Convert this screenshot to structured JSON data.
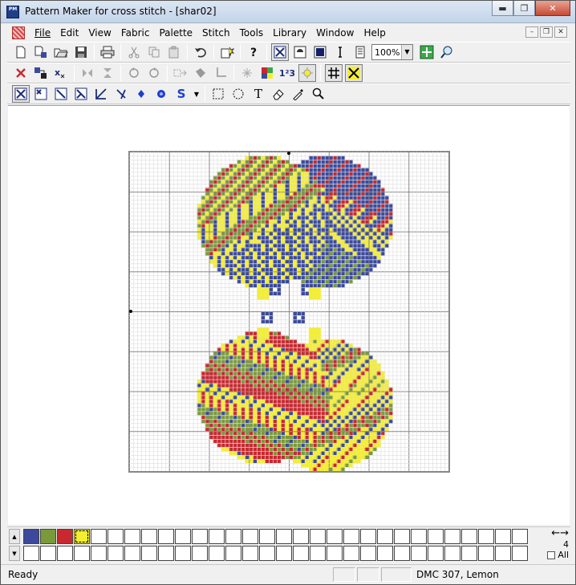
{
  "window": {
    "title": "Pattern Maker for cross stitch - [shar02]",
    "app_icon_text": "PM"
  },
  "menubar": {
    "items": [
      "File",
      "Edit",
      "View",
      "Fabric",
      "Palette",
      "Stitch",
      "Tools",
      "Library",
      "Window",
      "Help"
    ]
  },
  "toolbar1": {
    "zoom_value": "100%",
    "icons": [
      "new-icon",
      "copy-new-icon",
      "open-icon",
      "save-icon",
      "print-icon",
      "cut-icon",
      "copy-icon",
      "paste-icon",
      "undo-icon",
      "paste-special-icon",
      "help-icon",
      "full-stitch-view-icon",
      "symbol-view-icon",
      "block-view-icon",
      "text-icon",
      "pattern-info-icon",
      "zoom-fit-icon",
      "zoom-tool-icon"
    ]
  },
  "toolbar2": {
    "icons": [
      "delete-icon",
      "move-icon",
      "swap-color-icon",
      "flip-horizontal-icon",
      "flip-vertical-icon",
      "rotate-left-icon",
      "rotate-right-icon",
      "shift-icon",
      "fill-icon",
      "crop-icon",
      "select-icon",
      "palette-icon",
      "numbers-icon",
      "sparkle-icon",
      "grid-icon",
      "show-stitches-icon"
    ],
    "numbers_label": "1²3"
  },
  "toolbar3": {
    "icons": [
      "full-stitch-icon",
      "quarter-stitch-icon",
      "half-stitch-icon",
      "three-quarter-stitch-icon",
      "backstitch-icon",
      "straight-stitch-icon",
      "french-knot-icon",
      "bead-icon",
      "specialty-stitch-icon",
      "rectangle-select-icon",
      "lasso-select-icon",
      "text-tool-icon",
      "eraser-icon",
      "color-picker-icon",
      "magnifier-icon"
    ],
    "specialty_label": "S",
    "text_label": "T"
  },
  "palette": {
    "colors": [
      "#3b4a9c",
      "#7a9a3a",
      "#c8282f",
      "#f4ee30"
    ],
    "selected_index": 3,
    "empty_slots_row1": 26,
    "empty_slots_row2": 30,
    "page_number": "4",
    "all_label": "All"
  },
  "status": {
    "text": "Ready",
    "current_color": "DMC  307, Lemon"
  },
  "colors": {
    "blue": "#3b4a9c",
    "green": "#7a9a3a",
    "red": "#c8282f",
    "yellow": "#f4ee30"
  }
}
